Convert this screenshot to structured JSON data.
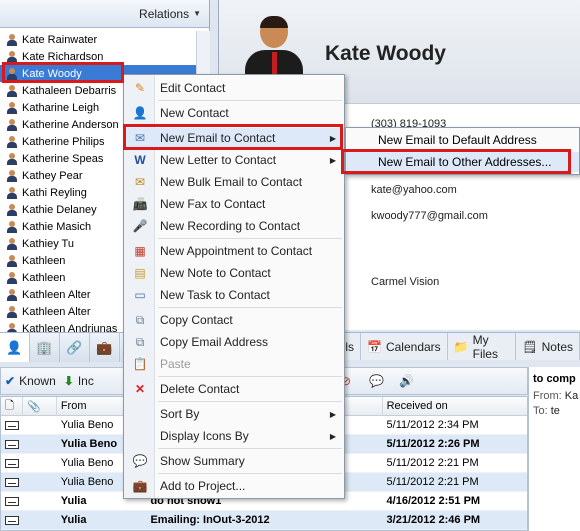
{
  "relations": {
    "label": "Relations"
  },
  "contacts": [
    "Kate Rainwater",
    "Kate Richardson",
    "Kate Woody",
    "Kathaleen Debarris",
    "Katharine Leigh",
    "Katherine Anderson",
    "Katherine Philips",
    "Katherine Speas",
    "Kathey Pear",
    "Kathi Reyling",
    "Kathie Delaney",
    "Kathie Masich",
    "Kathiey Tu",
    "Kathleen",
    "Kathleen",
    "Kathleen Alter",
    "Kathleen Alter",
    "Kathleen Andriunas"
  ],
  "selected_contact": "Kate Woody",
  "detail": {
    "name": "Kate Woody",
    "phone": "(303) 819-1093",
    "email1": "kate@yahoo.com",
    "email2": "kwoody777@gmail.com",
    "company": "Carmel Vision"
  },
  "right_tabs": [
    "ails",
    "Calendars",
    "My Files",
    "Notes"
  ],
  "toolbar": {
    "known": "Known",
    "inc": "Inc"
  },
  "grid": {
    "columns": [
      "From",
      "Received on"
    ],
    "rows": [
      {
        "from": "Yulia Beno",
        "subject": "",
        "date": "5/11/2012 2:34 PM",
        "bold": false
      },
      {
        "from": "Yulia Beno",
        "subject": "",
        "date": "5/11/2012 2:26 PM",
        "bold": true
      },
      {
        "from": "Yulia Beno",
        "subject": "",
        "date": "5/11/2012 2:21 PM",
        "bold": false
      },
      {
        "from": "Yulia Beno",
        "subject": "",
        "date": "5/11/2012 2:21 PM",
        "bold": false
      },
      {
        "from": "Yulia",
        "subject": "do not show1",
        "date": "4/16/2012 2:51 PM",
        "bold": true
      },
      {
        "from": "Yulia",
        "subject": "Emailing: InOut-3-2012",
        "date": "3/21/2012 2:46 PM",
        "bold": true
      }
    ]
  },
  "preview": {
    "title": "to comp",
    "from_label": "From:",
    "from_val": "Ka",
    "to_label": "To:",
    "to_val": "te"
  },
  "menu": {
    "edit_contact": "Edit Contact",
    "new_contact": "New Contact",
    "new_email": "New Email to Contact",
    "new_letter": "New Letter to Contact",
    "new_bulk": "New Bulk Email to Contact",
    "new_fax": "New Fax to Contact",
    "new_recording": "New Recording to Contact",
    "new_appointment": "New Appointment to Contact",
    "new_note": "New Note to Contact",
    "new_task": "New Task to Contact",
    "copy_contact": "Copy Contact",
    "copy_email": "Copy Email Address",
    "paste": "Paste",
    "delete_contact": "Delete Contact",
    "sort_by": "Sort By",
    "display_icons_by": "Display Icons By",
    "show_summary": "Show Summary",
    "add_to_project": "Add to Project..."
  },
  "submenu": {
    "default": "New Email to Default Address",
    "other": "New Email to Other Addresses..."
  }
}
